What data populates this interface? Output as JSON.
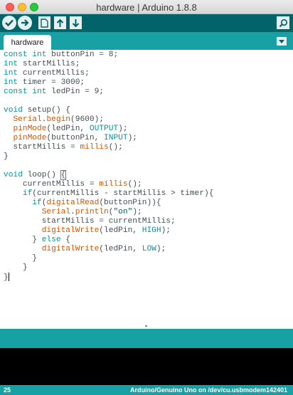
{
  "window": {
    "title": "hardware | Arduino 1.8.8"
  },
  "toolbar": {
    "buttons": [
      {
        "name": "verify",
        "icon": "checkmark-icon"
      },
      {
        "name": "upload",
        "icon": "arrow-right-icon"
      },
      {
        "name": "new",
        "icon": "new-file-icon"
      },
      {
        "name": "open",
        "icon": "arrow-up-icon"
      },
      {
        "name": "save",
        "icon": "arrow-down-icon"
      }
    ],
    "serial_monitor_icon": "magnifier-icon"
  },
  "tabs": [
    {
      "label": "hardware",
      "active": true
    }
  ],
  "editor": {
    "lines": [
      "const int buttonPin = 8;",
      "int startMillis;",
      "int currentMillis;",
      "int timer = 3000;",
      "const int ledPin = 9;",
      "",
      "void setup() {",
      "  Serial.begin(9600);",
      "  pinMode(ledPin, OUTPUT);",
      "  pinMode(buttonPin, INPUT);",
      "  startMillis = millis();",
      "}",
      "",
      "void loop() {",
      "    currentMillis = millis();",
      "    if(currentMillis - startMillis > timer){",
      "      if(digitalRead(buttonPin)){",
      "        Serial.println(\"on\");",
      "        startMillis = currentMillis;",
      "        digitalWrite(ledPin, HIGH);",
      "      } else {",
      "        digitalWrite(ledPin, LOW);",
      "      }",
      "    }",
      "}"
    ]
  },
  "status": {
    "line_number": "25",
    "board": "Arduino/Genuino Uno on /dev/cu.usbmodem142401"
  },
  "colors": {
    "toolbar": "#006468",
    "tabbar": "#17a1a5",
    "keyword": "#00979c",
    "function": "#d35400",
    "console": "#000000"
  }
}
